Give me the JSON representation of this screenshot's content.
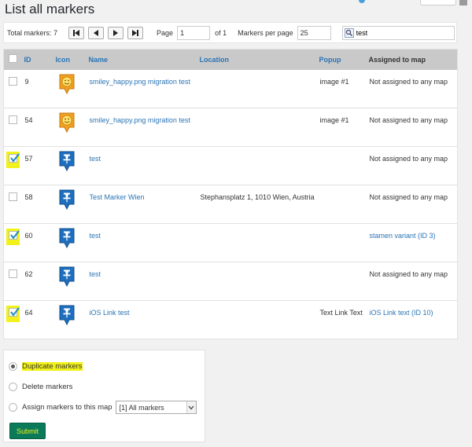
{
  "page": {
    "title": "List all markers"
  },
  "toolbar": {
    "total_label": "Total markers: 7",
    "page_label": "Page",
    "page_value": "1",
    "of_label": "of 1",
    "per_page_label": "Markers per page",
    "per_page_value": "25",
    "search_value": "test"
  },
  "table": {
    "columns": [
      "ID",
      "Icon",
      "Name",
      "Location",
      "Popup",
      "Assigned to map"
    ],
    "rows": [
      {
        "id": "9",
        "icon": "smiley-marker-icon",
        "name": "smiley_happy.png migration test",
        "location": "",
        "popup": "image #1",
        "assigned": "Not assigned to any map",
        "checked": false,
        "assigned_link": false
      },
      {
        "id": "54",
        "icon": "smiley-marker-icon",
        "name": "smiley_happy.png migration test",
        "location": "",
        "popup": "image #1",
        "assigned": "Not assigned to any map",
        "checked": false,
        "assigned_link": false
      },
      {
        "id": "57",
        "icon": "pin-marker-icon",
        "name": "test",
        "location": "",
        "popup": "",
        "assigned": "Not assigned to any map",
        "checked": true,
        "assigned_link": false
      },
      {
        "id": "58",
        "icon": "pin-marker-icon",
        "name": "Test Marker Wien",
        "location": "Stephansplatz 1, 1010 Wien, Austria",
        "popup": "",
        "assigned": "Not assigned to any map",
        "checked": false,
        "assigned_link": false
      },
      {
        "id": "60",
        "icon": "pin-marker-icon",
        "name": "test",
        "location": "",
        "popup": "",
        "assigned": "stamen variant (ID 3)",
        "checked": true,
        "assigned_link": true
      },
      {
        "id": "62",
        "icon": "pin-marker-icon",
        "name": "test",
        "location": "",
        "popup": "",
        "assigned": "Not assigned to any map",
        "checked": false,
        "assigned_link": false
      },
      {
        "id": "64",
        "icon": "pin-marker-icon",
        "name": "iOS Link test",
        "location": "",
        "popup": "Text Link Text",
        "assigned": "iOS Link text (ID 10)",
        "checked": true,
        "assigned_link": true
      }
    ]
  },
  "actions": {
    "duplicate_label": "Duplicate markers",
    "delete_label": "Delete markers",
    "assign_label": "Assign markers to this map",
    "map_select_value": "[1] All markers",
    "submit_label": "Submit",
    "selected": "duplicate"
  },
  "colors": {
    "link": "#2a74b5",
    "highlight": "#f2f21a",
    "submit": "#0a7a5a",
    "marker_blue": "#1f6fbf",
    "marker_orange": "#f0a020"
  }
}
